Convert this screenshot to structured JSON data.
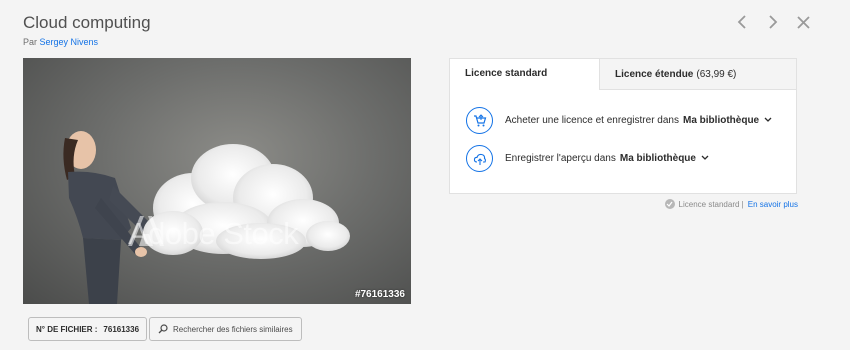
{
  "header": {
    "title": "Cloud computing",
    "by_prefix": "Par",
    "author": "Sergey Nivens"
  },
  "nav": {
    "prev_icon": "chevron-left-icon",
    "next_icon": "chevron-right-icon",
    "close_icon": "close-icon"
  },
  "image": {
    "watermark": "Adobe Stock",
    "file_tag": "#76161336"
  },
  "file_info": {
    "label": "N° DE FICHIER :",
    "value": "76161336"
  },
  "similar": {
    "label": "Rechercher des fichiers similaires",
    "icon": "search-icon"
  },
  "tabs": [
    {
      "label": "Licence standard",
      "price": ""
    },
    {
      "label": "Licence étendue",
      "price": "(63,99 €)"
    }
  ],
  "options": [
    {
      "icon": "cart-icon",
      "text": "Acheter une licence et enregistrer dans",
      "library": "Ma bibliothèque"
    },
    {
      "icon": "cloud-upload-icon",
      "text": "Enregistrer l'aperçu dans",
      "library": "Ma bibliothèque"
    }
  ],
  "license_note": {
    "text": "Licence standard |",
    "link": "En savoir plus"
  },
  "colors": {
    "accent": "#1473e6",
    "background": "#f4f4f4"
  }
}
